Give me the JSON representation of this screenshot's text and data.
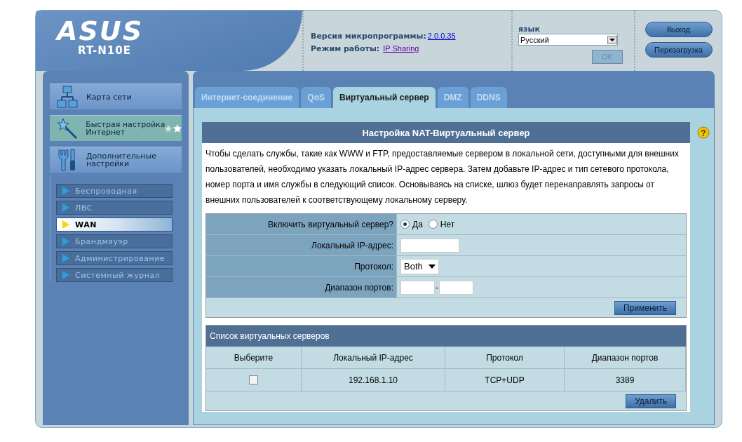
{
  "header": {
    "logo": "ASUS",
    "model": "RT-N10E",
    "firmware_label": "Версия микропрограммы:",
    "firmware_version": "2.0.0.35",
    "mode_label": "Режим работы:",
    "mode_value": "IP Sharing",
    "language_label": "язык",
    "language_value": "Русский",
    "ok_button": "OK",
    "logout_button": "Выход",
    "reboot_button": "Перезагрузка"
  },
  "sidebar": {
    "main_items": [
      {
        "label": "Карта сети",
        "kind": "map",
        "selected": false
      },
      {
        "label": "Быстрая настройка Интернет",
        "kind": "wizard",
        "selected": true
      },
      {
        "label": "Дополнительные настройки",
        "kind": "tools",
        "selected": false
      }
    ],
    "sub_items": [
      {
        "label": "Беспроводная",
        "selected": false
      },
      {
        "label": "ЛВС",
        "selected": false
      },
      {
        "label": "WAN",
        "selected": true
      },
      {
        "label": "Брандмауэр",
        "selected": false
      },
      {
        "label": "Администрирование",
        "selected": false
      },
      {
        "label": "Системный журнал",
        "selected": false
      }
    ]
  },
  "help_glyph": "?",
  "tabs": [
    {
      "label": "Интернет-соединение",
      "selected": false
    },
    {
      "label": "QoS",
      "selected": false
    },
    {
      "label": "Виртуальный сервер",
      "selected": true
    },
    {
      "label": "DMZ",
      "selected": false
    },
    {
      "label": "DDNS",
      "selected": false
    }
  ],
  "panel": {
    "title": "Настройка NAT-Виртуальный сервер",
    "description": "Чтобы сделать службы, такие как WWW и FTP, предоставляемые сервером в локальной сети, доступными для внешних пользователей, необходимо указать локальный IP-адрес сервера. Затем добавьте IP-адрес и тип сетевого протокола, номер порта и имя службы в следующий список. Основываясь на списке, шлюз будет перенаправлять запросы от внешних пользователей к соответствующему локальному серверу.",
    "form": {
      "enable_label": "Включить виртуальный сервер?",
      "enable_options": [
        {
          "label": "Да",
          "selected": true
        },
        {
          "label": "Нет",
          "selected": false
        }
      ],
      "ip_label": "Локальный IP-адрес:",
      "protocol_label": "Протокол:",
      "protocol_value": "Both",
      "port_label": "Диапазон портов:",
      "port_separator": "-",
      "apply_button": "Применить"
    },
    "list": {
      "title": "Список виртуальных серверов",
      "columns": [
        "Выберите",
        "Локальный IP-адрес",
        "Протокол",
        "Диапазон портов"
      ],
      "rows": [
        {
          "checked": false,
          "ip": "192.168.1.10",
          "protocol": "TCP+UDP",
          "ports": "3389"
        }
      ],
      "delete_button": "Удалить"
    }
  }
}
